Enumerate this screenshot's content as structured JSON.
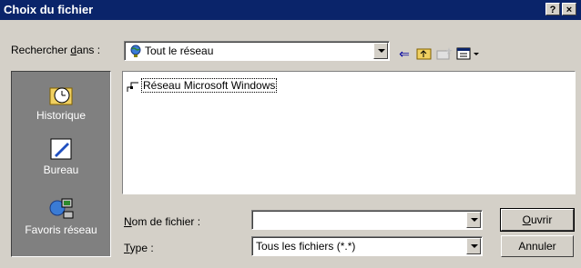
{
  "window": {
    "title": "Choix du fichier",
    "help_label": "?",
    "close_label": "×"
  },
  "lookin": {
    "label_prefix": "Rechercher ",
    "label_underlined": "d",
    "label_suffix": "ans :",
    "value": "Tout le réseau"
  },
  "files": [
    {
      "name": "Réseau Microsoft Windows"
    }
  ],
  "places": [
    {
      "label": "Historique",
      "icon": "history-icon"
    },
    {
      "label": "Bureau",
      "icon": "desktop-icon"
    },
    {
      "label": "Favoris réseau",
      "icon": "network-places-icon"
    }
  ],
  "filename": {
    "label_underlined": "N",
    "label_rest": "om de fichier :",
    "value": ""
  },
  "filetype": {
    "label_underlined": "T",
    "label_rest": "ype :",
    "value": "Tous les fichiers (*.*)"
  },
  "buttons": {
    "open_underlined": "O",
    "open_rest": "uvrir",
    "cancel": "Annuler"
  }
}
